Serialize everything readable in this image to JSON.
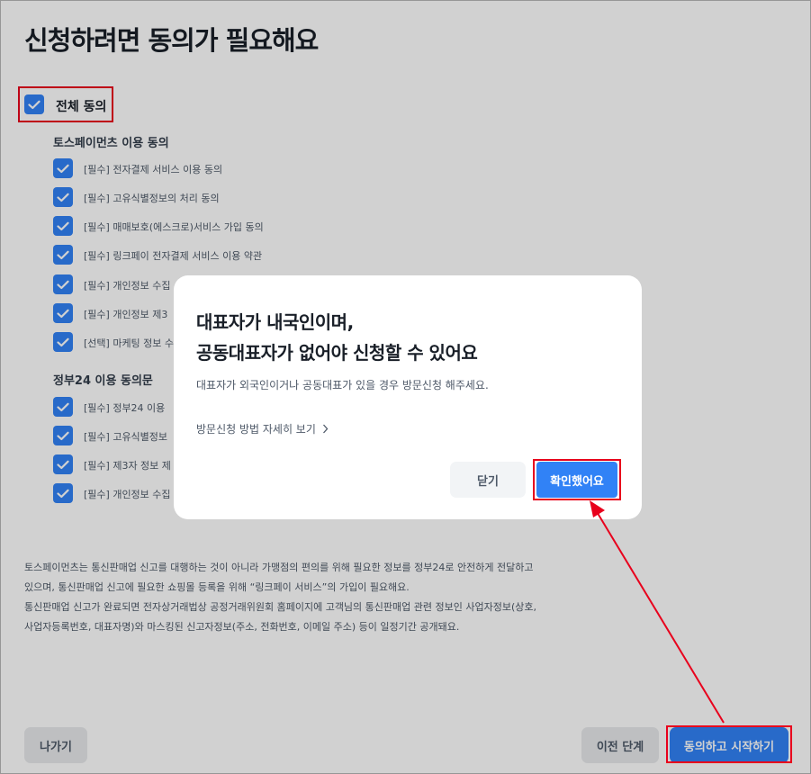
{
  "page": {
    "title": "신청하려면 동의가 필요해요",
    "all_agree_label": "전체 동의"
  },
  "sections": [
    {
      "title": "토스페이먼츠 이용 동의",
      "items": [
        {
          "label": "[필수] 전자결제 서비스 이용 동의",
          "checked": true
        },
        {
          "label": "[필수] 고유식별정보의 처리 동의",
          "checked": true
        },
        {
          "label": "[필수] 매매보호(에스크로)서비스 가입 동의",
          "checked": true
        },
        {
          "label": "[필수] 링크페이 전자결제 서비스 이용 약관",
          "checked": true
        },
        {
          "label": "[필수] 개인정보 수집",
          "checked": true
        },
        {
          "label": "[필수] 개인정보 제3",
          "checked": true
        },
        {
          "label": "[선택] 마케팅 정보 수",
          "checked": true
        }
      ]
    },
    {
      "title": "정부24 이용 동의문",
      "items": [
        {
          "label": "[필수] 정부24 이용",
          "checked": true
        },
        {
          "label": "[필수] 고유식별정보",
          "checked": true
        },
        {
          "label": "[필수] 제3자 정보 제",
          "checked": true
        },
        {
          "label": "[필수] 개인정보 수집",
          "checked": true
        }
      ]
    }
  ],
  "notice": {
    "lines": [
      "토스페이먼츠는 통신판매업 신고를 대행하는 것이 아니라 가맹점의 편의를 위해 필요한 정보를 정부24로 안전하게 전달하고",
      "있으며, 통신판매업 신고에 필요한 쇼핑몰 등록을 위해 “링크페이 서비스”의 가입이 필요해요.",
      "통신판매업 신고가 완료되면 전자상거래법상 공정거래위원회 홈페이지에 고객님의 통신판매업 관련 정보인 사업자정보(상호,",
      "사업자등록번호, 대표자명)와 마스킹된 신고자정보(주소, 전화번호, 이메일 주소) 등이 일정기간 공개돼요."
    ]
  },
  "footer": {
    "exit_label": "나가기",
    "prev_label": "이전 단계",
    "start_label": "동의하고 시작하기"
  },
  "modal": {
    "title_line1": "대표자가 내국인이며,",
    "title_line2": "공동대표자가 없어야 신청할 수 있어요",
    "description": "대표자가 외국인이거나 공동대표가 있을 경우 방문신청 해주세요.",
    "link_label": "방문신청 방법 자세히 보기",
    "link_icon": "chevron-right-icon",
    "close_label": "닫기",
    "confirm_label": "확인했어요"
  },
  "colors": {
    "accent": "#3182f6",
    "highlight": "#e8001c"
  }
}
